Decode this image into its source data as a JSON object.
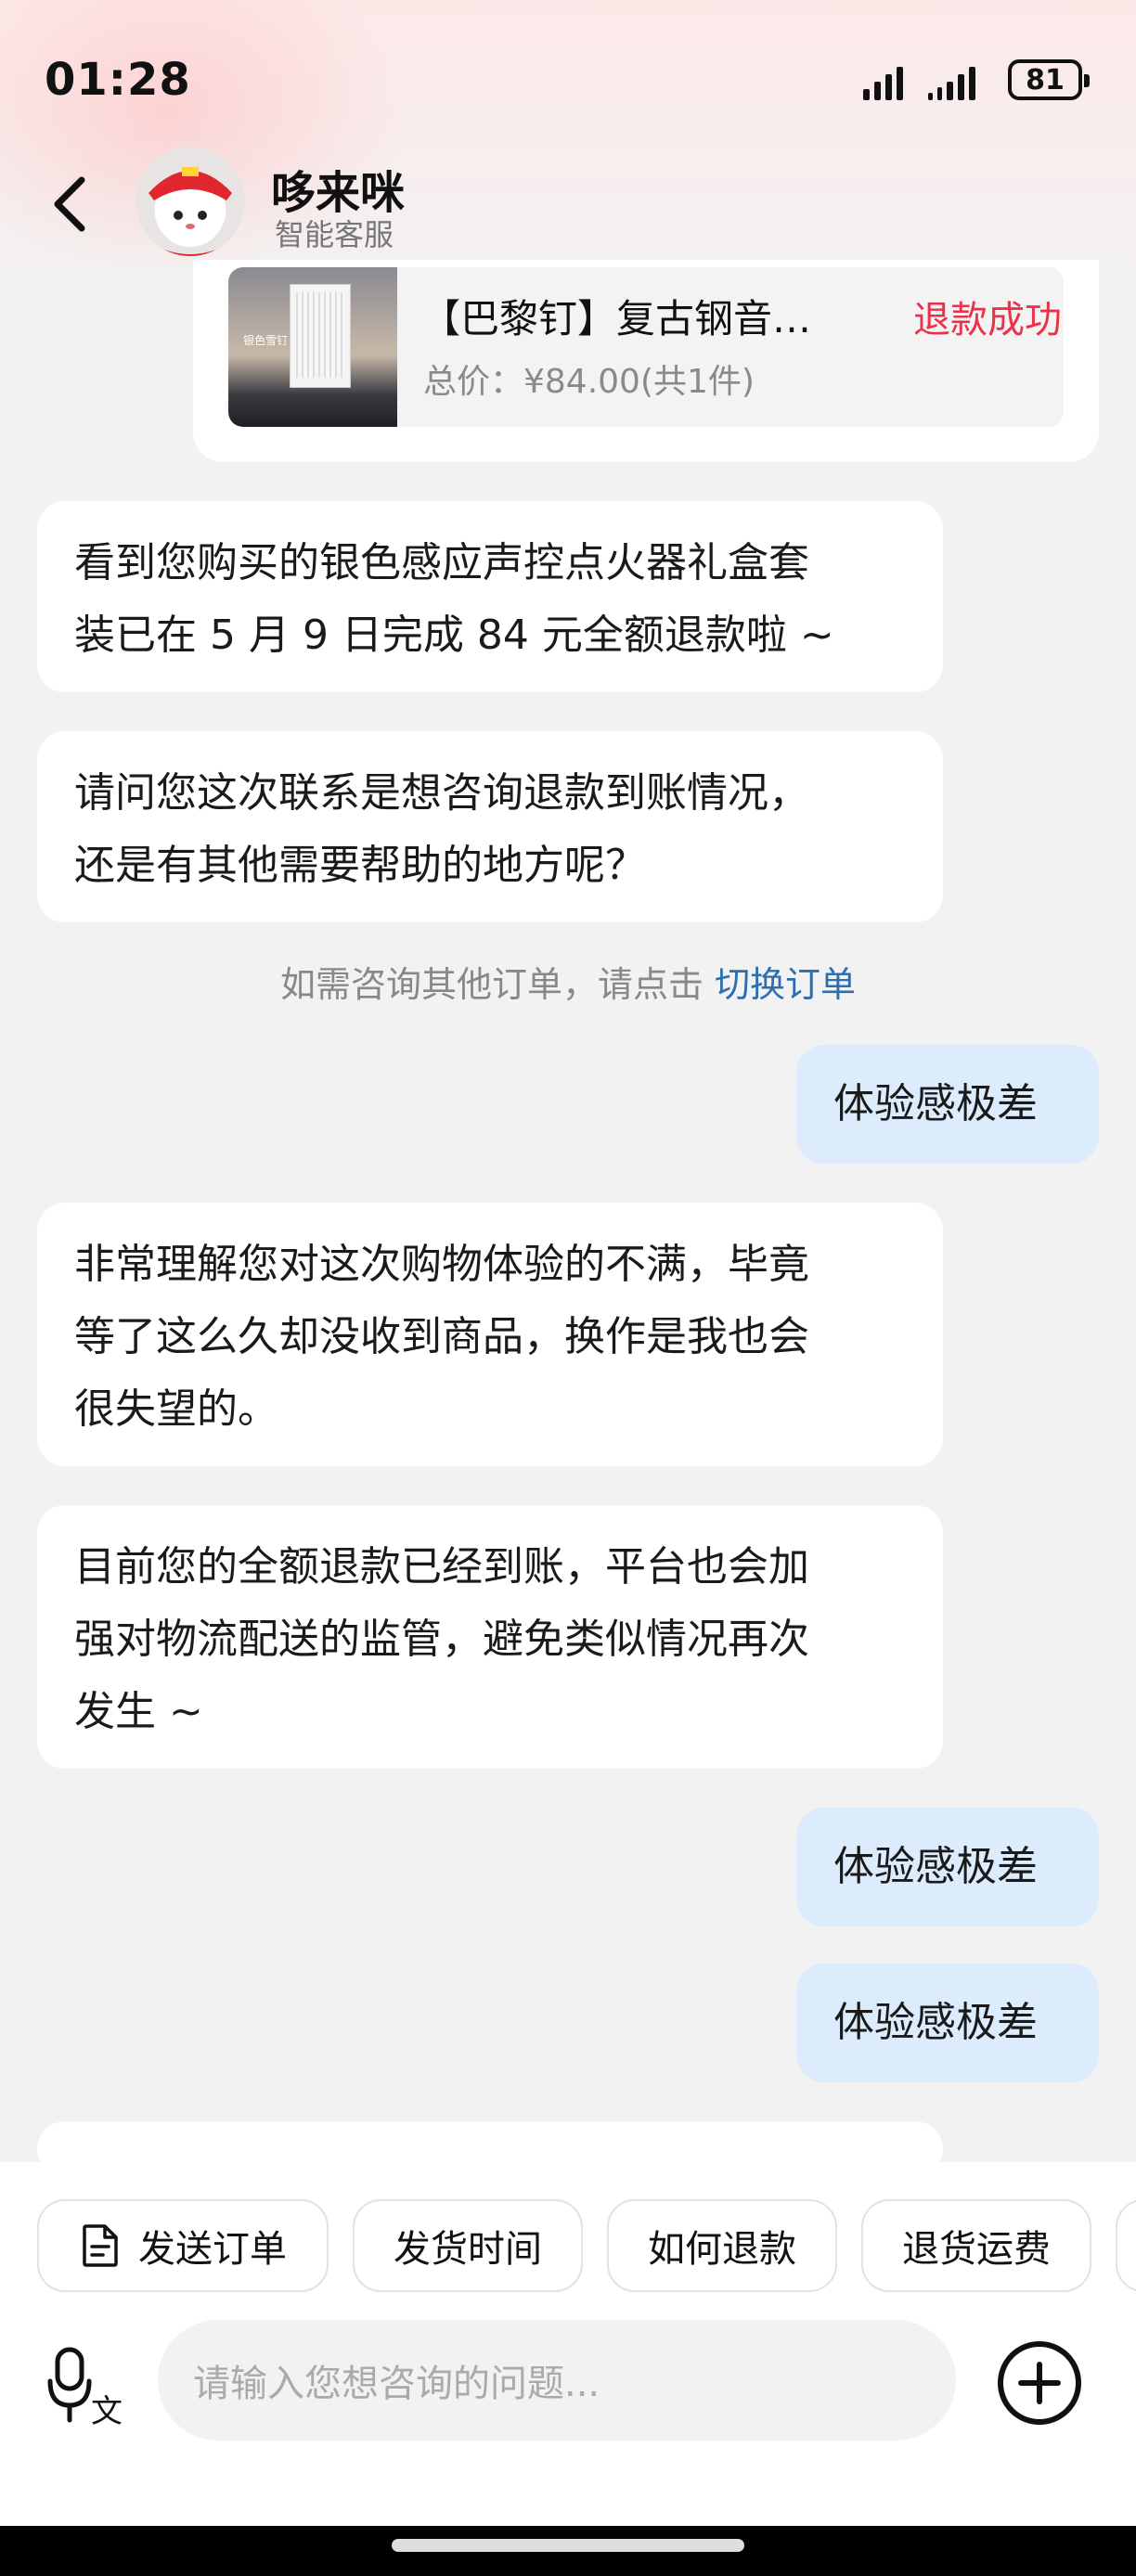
{
  "status_bar": {
    "time": "01:28",
    "battery": "81"
  },
  "header": {
    "name": "哆来咪",
    "subtitle": "智能客服"
  },
  "order": {
    "image_label": "银色雪钉",
    "title": "【巴黎钉】复古钢音…",
    "status": "退款成功",
    "price": "总价：¥84.00(共1件)"
  },
  "messages": [
    {
      "from": "agent",
      "lines": [
        "看到您购买的银色感应声控点火器礼盒套",
        "装已在 5 月 9 日完成 84 元全额退款啦 ~"
      ]
    },
    {
      "from": "agent",
      "lines": [
        "请问您这次联系是想咨询退款到账情况，",
        "还是有其他需要帮助的地方呢？"
      ]
    },
    {
      "from": "user",
      "text": "体验感极差"
    },
    {
      "from": "agent",
      "lines": [
        "非常理解您对这次购物体验的不满，毕竟",
        "等了这么久却没收到商品，换作是我也会",
        "很失望的。"
      ]
    },
    {
      "from": "agent",
      "lines": [
        "目前您的全额退款已经到账，平台也会加",
        "强对物流配送的监管，避免类似情况再次",
        "发生 ~"
      ]
    },
    {
      "from": "user",
      "text": "体验感极差"
    },
    {
      "from": "user",
      "text": "体验感极差"
    }
  ],
  "hint": {
    "text": "如需咨询其他订单，请点击 ",
    "link": "切换订单"
  },
  "quick_actions": [
    "发送订单",
    "发货时间",
    "如何退款",
    "退货运费"
  ],
  "input": {
    "placeholder": "请输入您想咨询的问题..."
  },
  "icons": [
    "back-arrow-icon",
    "document-icon",
    "voice-translate-icon",
    "plus-circle-icon"
  ],
  "colors": {
    "accent_red": "#e8334a",
    "link_blue": "#2b6fb0",
    "user_bubble": "#dcecfd"
  }
}
